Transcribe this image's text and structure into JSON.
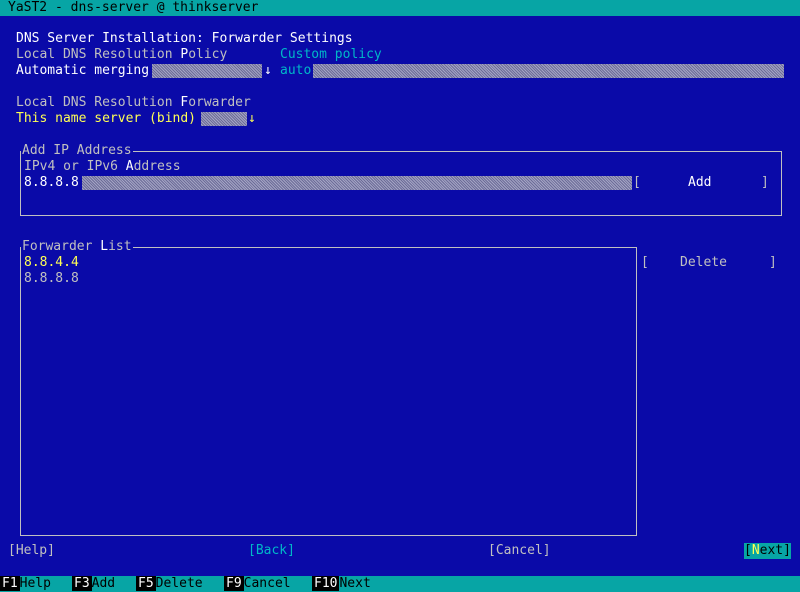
{
  "window": {
    "title": "YaST2 - dns-server @ thinkserver"
  },
  "dialog": {
    "heading": "DNS Server Installation: Forwarder Settings"
  },
  "policy": {
    "label_pre": "Local DNS Resolution ",
    "label_hot": "P",
    "label_post": "olicy",
    "value": "Automatic merging",
    "arrow": "↓",
    "custom_label": "Custom policy",
    "custom_value": "auto"
  },
  "forwarder": {
    "label_pre": "Local DNS Resolution ",
    "label_hot": "F",
    "label_post": "orwarder",
    "value": "This name server (bind)",
    "arrow": "↓"
  },
  "add_ip": {
    "frame_title": "Add IP Address",
    "label_pre": "IPv4 or IPv6 ",
    "label_hot": "A",
    "label_post": "ddress",
    "value": "8.8.8.8",
    "add_button": "Add",
    "bracket_open": "[",
    "bracket_close": "]"
  },
  "forwarder_list": {
    "frame_title_pre": "Forwarder ",
    "frame_title_hot": "L",
    "frame_title_post": "ist",
    "items": [
      "8.8.4.4",
      "8.8.8.8"
    ],
    "delete_button": "Delete",
    "bracket_open": "[",
    "bracket_close": "]"
  },
  "buttons": {
    "help": "[Help]",
    "back": "[Back]",
    "cancel": "[Cancel]",
    "next_open": "[",
    "next_hot": "N",
    "next_rest": "ext]"
  },
  "fkeys": [
    {
      "key": "F1",
      "label": "Help"
    },
    {
      "key": "F3",
      "label": "Add"
    },
    {
      "key": "F5",
      "label": "Delete"
    },
    {
      "key": "F9",
      "label": "Cancel"
    },
    {
      "key": "F10",
      "label": "Next"
    }
  ],
  "colors": {
    "background": "#0a0aa8",
    "bar": "#07a5a5",
    "highlight": "#ffff55",
    "custom": "#00b8c8"
  }
}
